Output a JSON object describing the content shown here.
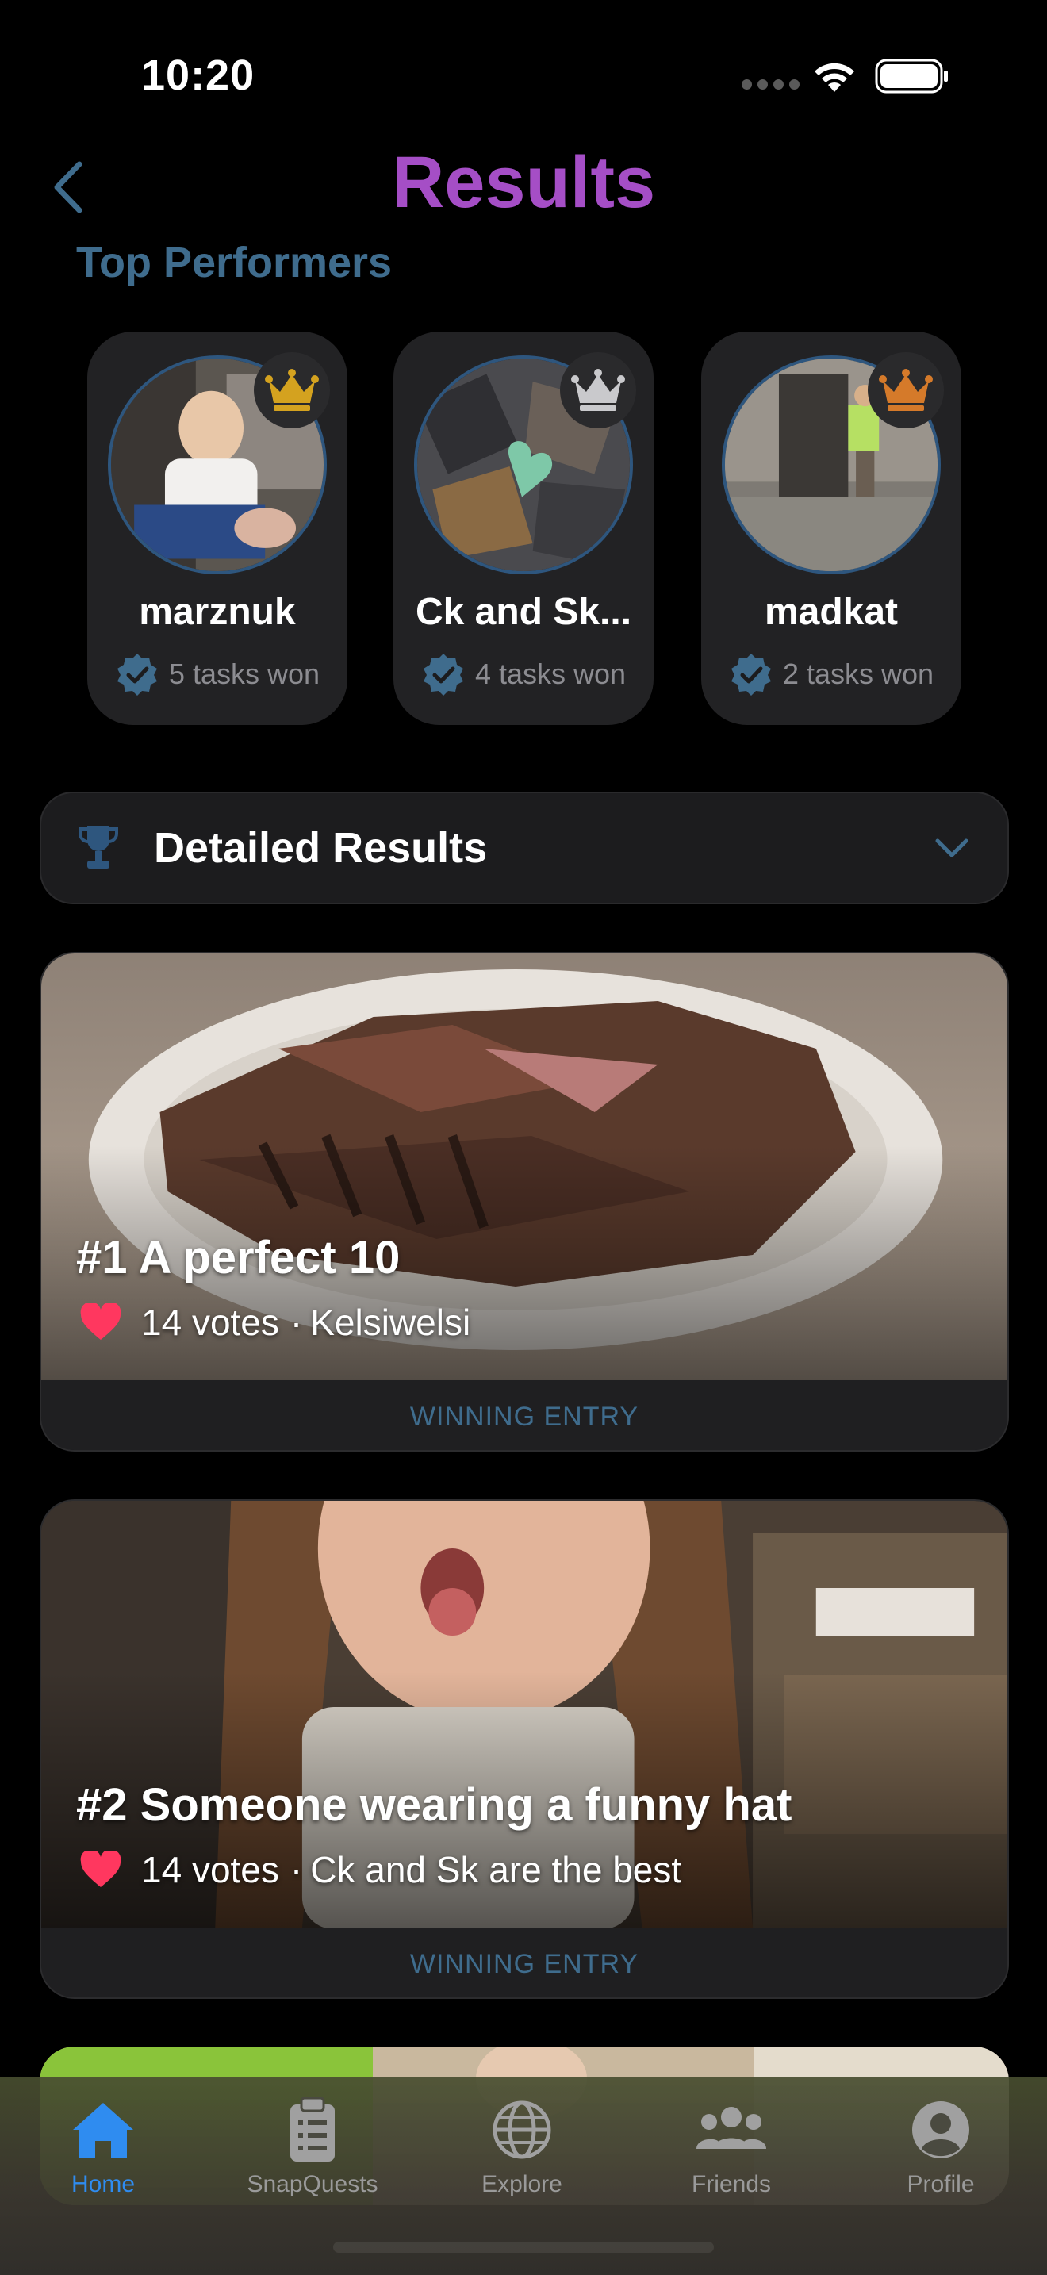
{
  "status_bar": {
    "time": "10:20"
  },
  "header": {
    "title": "Results"
  },
  "top_performers": {
    "title": "Top Performers",
    "items": [
      {
        "name": "marznuk",
        "tasks": "5 tasks won",
        "crown": "gold-crown-icon",
        "crown_color": "#d4a21f"
      },
      {
        "name": "Ck and Sk...",
        "tasks": "4 tasks won",
        "crown": "silver-crown-icon",
        "crown_color": "#c9c9cc"
      },
      {
        "name": "madkat",
        "tasks": "2 tasks won",
        "crown": "bronze-crown-icon",
        "crown_color": "#d57a2a"
      }
    ]
  },
  "detailed_results": {
    "label": "Detailed Results"
  },
  "entries": [
    {
      "title": "#1 A perfect 10",
      "votes": "14 votes",
      "author": "Kelsiwelsi",
      "footer": "WINNING ENTRY"
    },
    {
      "title": "#2 Someone wearing a funny hat",
      "votes": "14 votes",
      "author": "Ck and Sk are the best",
      "footer": "WINNING ENTRY"
    }
  ],
  "tab_bar": {
    "items": [
      {
        "label": "Home",
        "icon": "house-icon",
        "active": true
      },
      {
        "label": "SnapQuests",
        "icon": "clipboard-icon"
      },
      {
        "label": "Explore",
        "icon": "globe-icon"
      },
      {
        "label": "Friends",
        "icon": "people-icon"
      },
      {
        "label": "Profile",
        "icon": "person-circle-icon"
      }
    ]
  },
  "colors": {
    "accent_purple": "#a54ec6",
    "accent_blue": "#3f6c8d",
    "tab_active": "#2f8cf0",
    "heart_red": "#ff375f"
  }
}
